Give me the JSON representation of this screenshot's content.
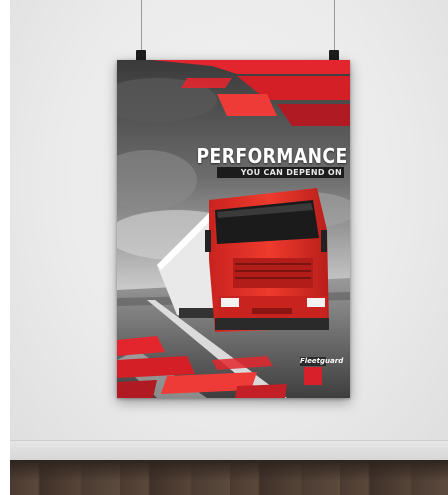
{
  "poster": {
    "headline": "PERFORMANCE",
    "subheadline": "YOU CAN DEPEND ON",
    "brand_logo_text": "Fleetguard"
  },
  "colors": {
    "accent_red": "#e3262d",
    "dark_red": "#b01a22",
    "wall": "#ececec",
    "floor": "#4f3e33"
  },
  "icons": {
    "brand_logo": "fleetguard-logo-icon",
    "hanging_clip": "binder-clip-icon"
  }
}
